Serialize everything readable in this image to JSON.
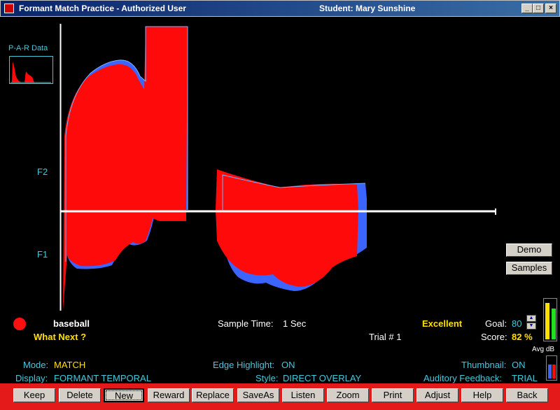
{
  "window": {
    "title": "Formant Match Practice - Authorized User",
    "student": "Student:  Mary Sunshine"
  },
  "par": {
    "label": "P-A-R Data"
  },
  "axis": {
    "f2": "F2",
    "f1": "F1"
  },
  "side_buttons": {
    "demo": "Demo",
    "samples": "Samples"
  },
  "status": {
    "word": "baseball",
    "what_next": "What Next ?",
    "sample_time_label": "Sample Time:",
    "sample_time_value": "1  Sec",
    "trial": "Trial # 1",
    "rating": "Excellent",
    "goal_label": "Goal:",
    "goal_value": "80",
    "score_label": "Score:",
    "score_value": "82 %",
    "avg_db": "Avg dB"
  },
  "settings": {
    "mode_label": "Mode:",
    "mode_value": "MATCH",
    "display_label": "Display:",
    "display_value": "FORMANT  TEMPORAL",
    "edge_label": "Edge Highlight:",
    "edge_value": "ON",
    "style_label": "Style:",
    "style_value": "DIRECT  OVERLAY",
    "thumb_label": "Thumbnail:",
    "thumb_value": "ON",
    "aud_label": "Auditory  Feedback:",
    "aud_value": "TRIAL"
  },
  "toolbar": {
    "keep": "Keep",
    "delete": "Delete",
    "new": "New",
    "reward": "Reward",
    "replace": "Replace",
    "saveas": "SaveAs",
    "listen": "Listen",
    "zoom": "Zoom",
    "print": "Print",
    "adjust": "Adjust",
    "help": "Help",
    "back": "Back"
  },
  "colors": {
    "student_fill": "#ff0a0a",
    "target_fill": "#3c64ff",
    "outline": "#7ab4ff",
    "accent": "#46c8dc",
    "toolbar": "#e41a1a",
    "rating": "#ffe000"
  }
}
